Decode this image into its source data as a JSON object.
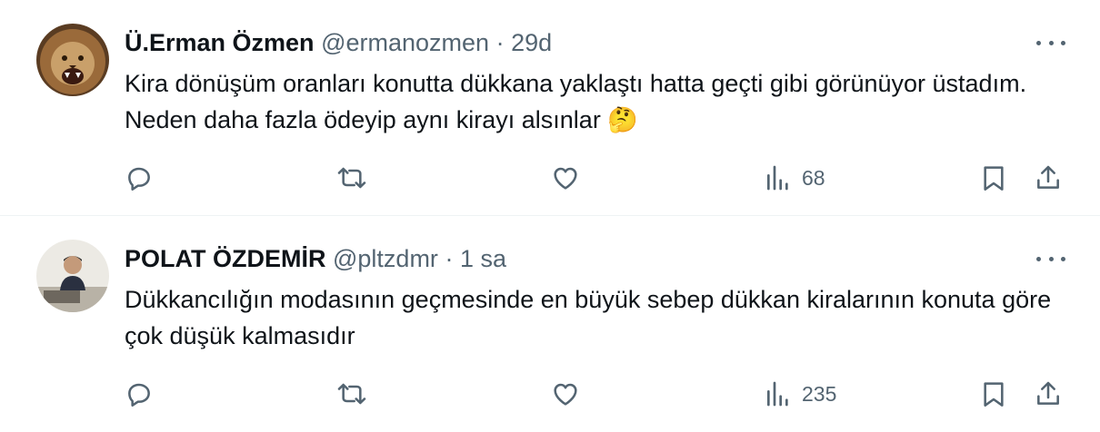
{
  "tweets": [
    {
      "name": "Ü.Erman Özmen",
      "handle": "@ermanozmen",
      "separator": "·",
      "time": "29d",
      "text": "Kira dönüşüm oranları konutta dükkana yaklaştı hatta geçti gibi görünüyor üstadım. Neden daha fazla ödeyip aynı kirayı alsınlar",
      "emoji": "🤔",
      "views": "68",
      "avatar_icon": "lion-avatar-icon"
    },
    {
      "name": "POLAT ÖZDEMİR",
      "handle": "@pltzdmr",
      "separator": "·",
      "time": "1 sa",
      "text": "Dükkancılığın modasının geçmesinde en büyük sebep dükkan kiralarının konuta göre çok düşük kalmasıdır",
      "views": "235",
      "avatar_icon": "person-avatar-icon"
    }
  ],
  "colors": {
    "text": "#0f1419",
    "muted": "#536471",
    "divider": "#eff3f4"
  }
}
